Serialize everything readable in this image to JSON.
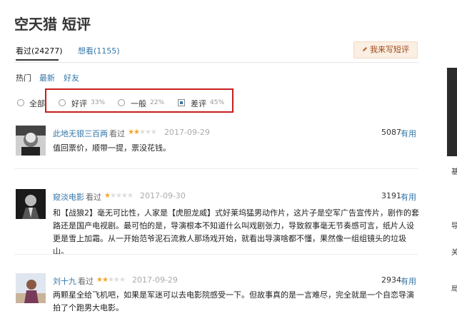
{
  "page_title": "空天猎 短评",
  "tabs": [
    {
      "label": "看过(24277)"
    },
    {
      "label": "想看(1155)"
    }
  ],
  "write_button": "我来写短评",
  "sort_tabs": [
    "热门",
    "最新",
    "好友"
  ],
  "filters": [
    {
      "label": "全部",
      "pct": ""
    },
    {
      "label": "好评",
      "pct": "33%"
    },
    {
      "label": "一般",
      "pct": "22%"
    },
    {
      "label": "差评",
      "pct": "45%"
    }
  ],
  "reviews": [
    {
      "user": "此地无银三百两",
      "action": "看过",
      "rating": 2,
      "date": "2017-09-29",
      "votes": "5087",
      "useful_label": "有用",
      "content": "值回票价，顺带一提，票没花钱。"
    },
    {
      "user": "窥淡电影",
      "action": "看过",
      "rating": 1,
      "date": "2017-09-30",
      "votes": "3191",
      "useful_label": "有用",
      "content": "和【战狼2】毫无可比性，人家是【虎胆龙威】式好莱坞猛男动作片，这片子是空军广告宣传片，剧作的套路还是国产电视剧。最可怕的是，导演根本不知道什么叫戏剧张力，导致叙事毫无节奏感可言，纸片人设更是雪上加霜。从一开始范爷泥石流救人那场戏开始，就看出导演啥都不懂，果然像一组组镜头的垃圾山。"
    },
    {
      "user": "刘十九",
      "action": "看过",
      "rating": 2,
      "date": "2017-09-29",
      "votes": "2934",
      "useful_label": "有用",
      "content": "两颗星全给飞机吧，如果是军迷可以去电影院感受一下。但故事真的是一言难尽，完全就是一个自恋导演拍了个跑男大电影。"
    }
  ],
  "right_fragments": [
    "基",
    "导",
    "关",
    "局"
  ],
  "colors": {
    "link": "#3377aa",
    "star": "#f5a623",
    "highlight": "#c81e1e",
    "write_bg": "#fbeee2"
  }
}
